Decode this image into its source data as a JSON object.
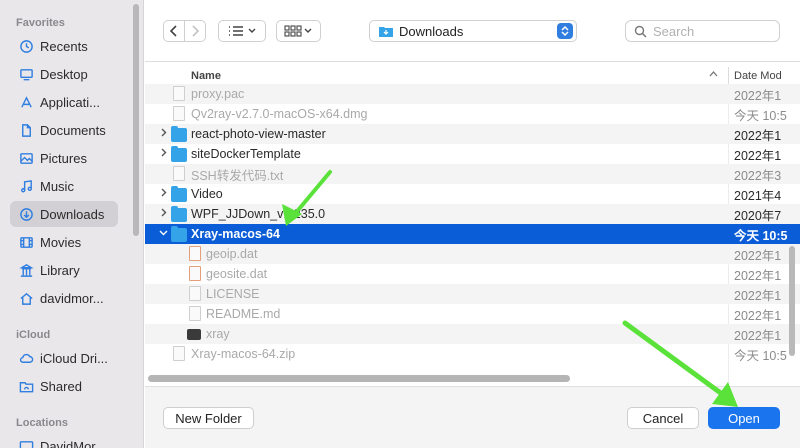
{
  "sidebar": {
    "sections": [
      {
        "label": "Favorites"
      },
      {
        "label": "iCloud"
      },
      {
        "label": "Locations"
      }
    ],
    "favorites": [
      {
        "label": "Recents",
        "icon": "clock-icon"
      },
      {
        "label": "Desktop",
        "icon": "desktop-icon"
      },
      {
        "label": "Applicati...",
        "icon": "applications-icon"
      },
      {
        "label": "Documents",
        "icon": "document-icon"
      },
      {
        "label": "Pictures",
        "icon": "pictures-icon"
      },
      {
        "label": "Music",
        "icon": "music-icon"
      },
      {
        "label": "Downloads",
        "icon": "download-icon",
        "selected": true
      },
      {
        "label": "Movies",
        "icon": "movies-icon"
      },
      {
        "label": "Library",
        "icon": "library-icon"
      },
      {
        "label": "davidmor...",
        "icon": "home-icon"
      }
    ],
    "icloud": [
      {
        "label": "iCloud Dri...",
        "icon": "cloud-icon"
      },
      {
        "label": "Shared",
        "icon": "shared-folder-icon"
      }
    ],
    "locations": [
      {
        "label": "DavidMor...",
        "icon": "computer-icon"
      }
    ]
  },
  "toolbar": {
    "location": "Downloads",
    "search_placeholder": "Search"
  },
  "list": {
    "col_name": "Name",
    "col_date": "Date Mod",
    "sort_indicator": "^",
    "rows": [
      {
        "name": "proxy.pac",
        "date": "2022年1",
        "kind": "doc",
        "dim": true,
        "indent": 0
      },
      {
        "name": "Qv2ray-v2.7.0-macOS-x64.dmg",
        "date": "今天 10:5",
        "kind": "dmg",
        "dim": true,
        "indent": 0
      },
      {
        "name": "react-photo-view-master",
        "date": "2022年1",
        "kind": "folder",
        "expand": "▶",
        "indent": 0
      },
      {
        "name": "siteDockerTemplate",
        "date": "2022年1",
        "kind": "folder",
        "expand": "▶",
        "indent": 0
      },
      {
        "name": "SSH转发代码.txt",
        "date": "2022年3",
        "kind": "doc",
        "dim": true,
        "indent": 0
      },
      {
        "name": "Video",
        "date": "2021年4",
        "kind": "folder",
        "expand": "▶",
        "indent": 0
      },
      {
        "name": "WPF_JJDown_v1.235.0",
        "date": "2020年7",
        "kind": "folder",
        "expand": "▶",
        "indent": 0
      },
      {
        "name": "Xray-macos-64",
        "date": "今天 10:5",
        "kind": "folder",
        "expand": "▼",
        "selected": true,
        "indent": 0
      },
      {
        "name": "geoip.dat",
        "date": "2022年1",
        "kind": "dat",
        "dim": true,
        "indent": 1
      },
      {
        "name": "geosite.dat",
        "date": "2022年1",
        "kind": "dat",
        "dim": true,
        "indent": 1
      },
      {
        "name": "LICENSE",
        "date": "2022年1",
        "kind": "doc",
        "dim": true,
        "indent": 1
      },
      {
        "name": "README.md",
        "date": "2022年1",
        "kind": "doc",
        "dim": true,
        "indent": 1
      },
      {
        "name": "xray",
        "date": "2022年1",
        "kind": "exec",
        "dim": true,
        "indent": 1
      },
      {
        "name": "Xray-macos-64.zip",
        "date": "今天 10:5",
        "kind": "zip",
        "dim": true,
        "indent": 0
      }
    ]
  },
  "footer": {
    "new_folder": "New Folder",
    "cancel": "Cancel",
    "open": "Open"
  },
  "colors": {
    "accent": "#1a74ee",
    "selection": "#0a5dd6",
    "folder": "#34a3e8",
    "annotation_arrow": "#5be23a"
  }
}
